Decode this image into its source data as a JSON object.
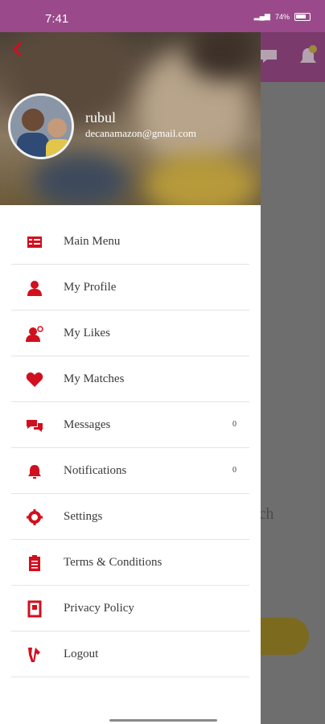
{
  "status_bar": {
    "time": "7:41",
    "battery": "74%"
  },
  "background": {
    "partial_text": "tch"
  },
  "profile": {
    "name": "rubul",
    "email": "decanamazon@gmail.com"
  },
  "menu": {
    "items": [
      {
        "label": "Main Menu",
        "icon": "menu-list-icon"
      },
      {
        "label": "My Profile",
        "icon": "person-icon"
      },
      {
        "label": "My Likes",
        "icon": "person-like-icon"
      },
      {
        "label": "My Matches",
        "icon": "heart-icon"
      },
      {
        "label": "Messages",
        "icon": "chat-icon",
        "count": "0"
      },
      {
        "label": "Notifications",
        "icon": "bell-icon",
        "count": "0"
      },
      {
        "label": "Settings",
        "icon": "gear-icon"
      },
      {
        "label": "Terms & Conditions",
        "icon": "clipboard-icon"
      },
      {
        "label": "Privacy Policy",
        "icon": "document-icon"
      },
      {
        "label": "Logout",
        "icon": "logout-icon"
      }
    ]
  },
  "colors": {
    "accent": "#d10f1e",
    "status_bar": "#9a4a8a",
    "header_bar": "#7a3b6c"
  }
}
